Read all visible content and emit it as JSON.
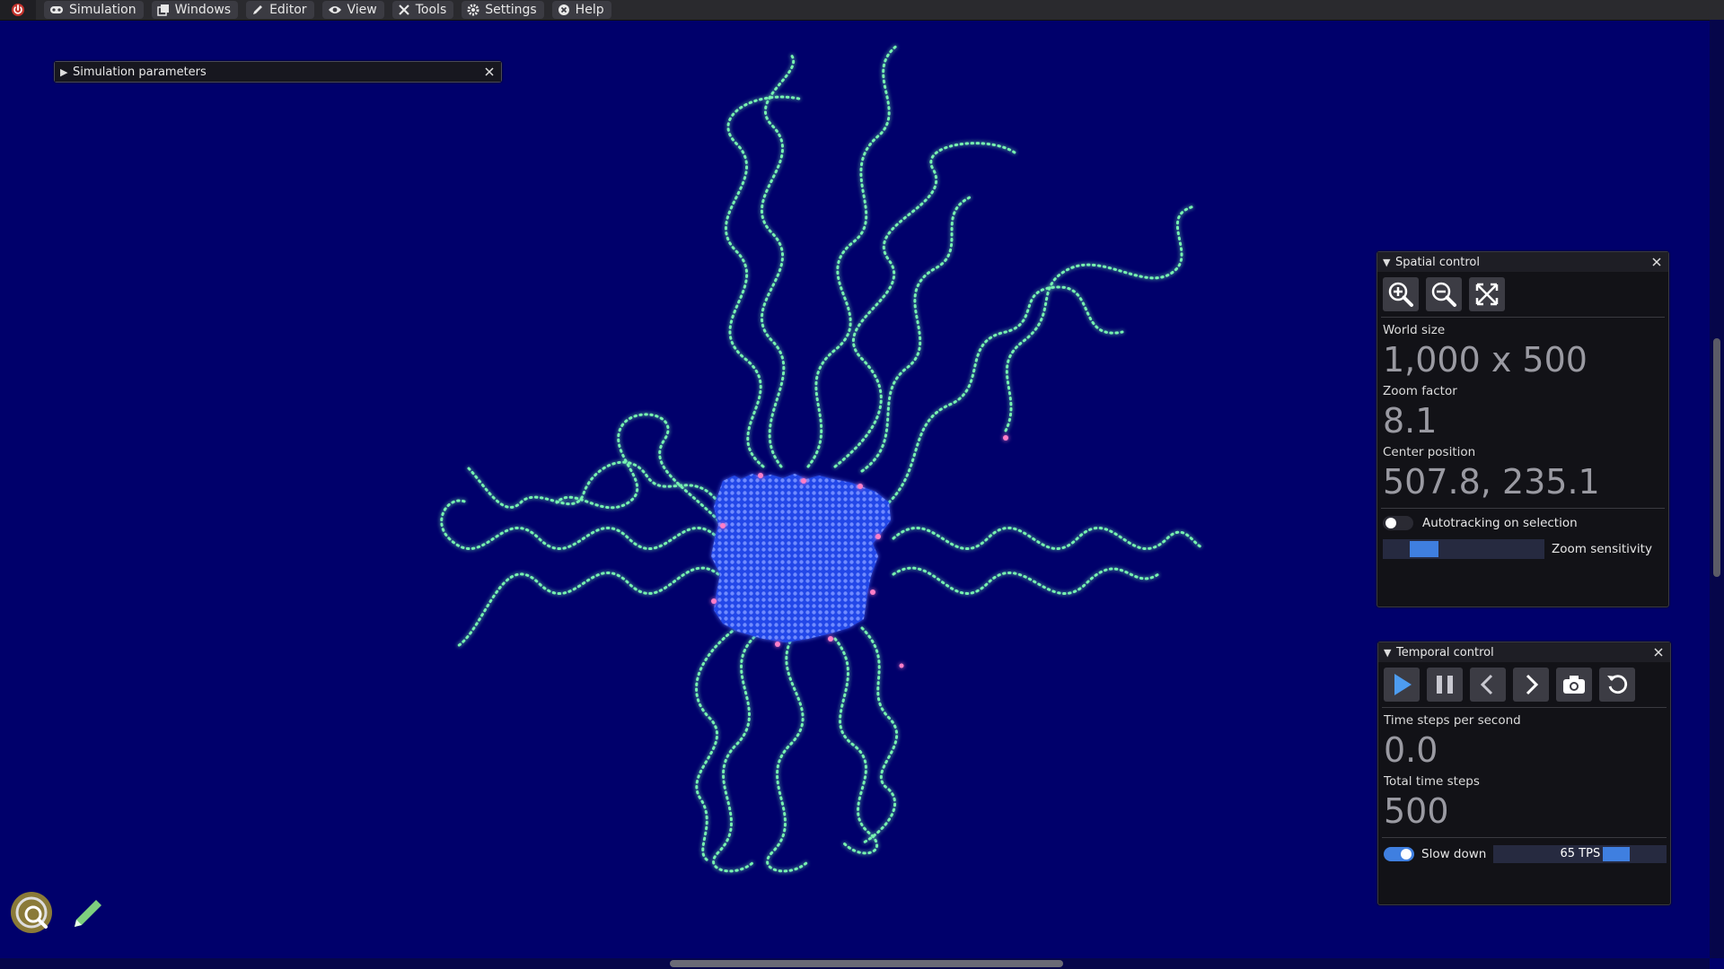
{
  "menubar": {
    "items": [
      {
        "label": "Simulation",
        "icon": "gamepad-icon"
      },
      {
        "label": "Windows",
        "icon": "windows-icon"
      },
      {
        "label": "Editor",
        "icon": "pencil-icon"
      },
      {
        "label": "View",
        "icon": "eye-icon"
      },
      {
        "label": "Tools",
        "icon": "tools-icon"
      },
      {
        "label": "Settings",
        "icon": "gear-icon"
      },
      {
        "label": "Help",
        "icon": "help-icon"
      }
    ]
  },
  "sim_params": {
    "title": "Simulation parameters"
  },
  "spatial": {
    "title": "Spatial control",
    "world_size_label": "World size",
    "world_size": "1,000 x 500",
    "zoom_factor_label": "Zoom factor",
    "zoom_factor": "8.1",
    "center_label": "Center position",
    "center": "507.8, 235.1",
    "autotracking_label": "Autotracking on selection",
    "autotracking_on": false,
    "zoom_sensitivity_label": "Zoom sensitivity"
  },
  "temporal": {
    "title": "Temporal control",
    "tps_label": "Time steps per second",
    "tps": "0.0",
    "total_label": "Total time steps",
    "total": "500",
    "slowdown_label": "Slow down",
    "slowdown_on": true,
    "slowdown_value": "65 TPS",
    "slowdown_fraction": 0.75
  },
  "colors": {
    "background": "#00006b",
    "particles_green": "#7dffb4",
    "particles_blue": "#3a64ff",
    "accent": "#3f7fe0"
  }
}
